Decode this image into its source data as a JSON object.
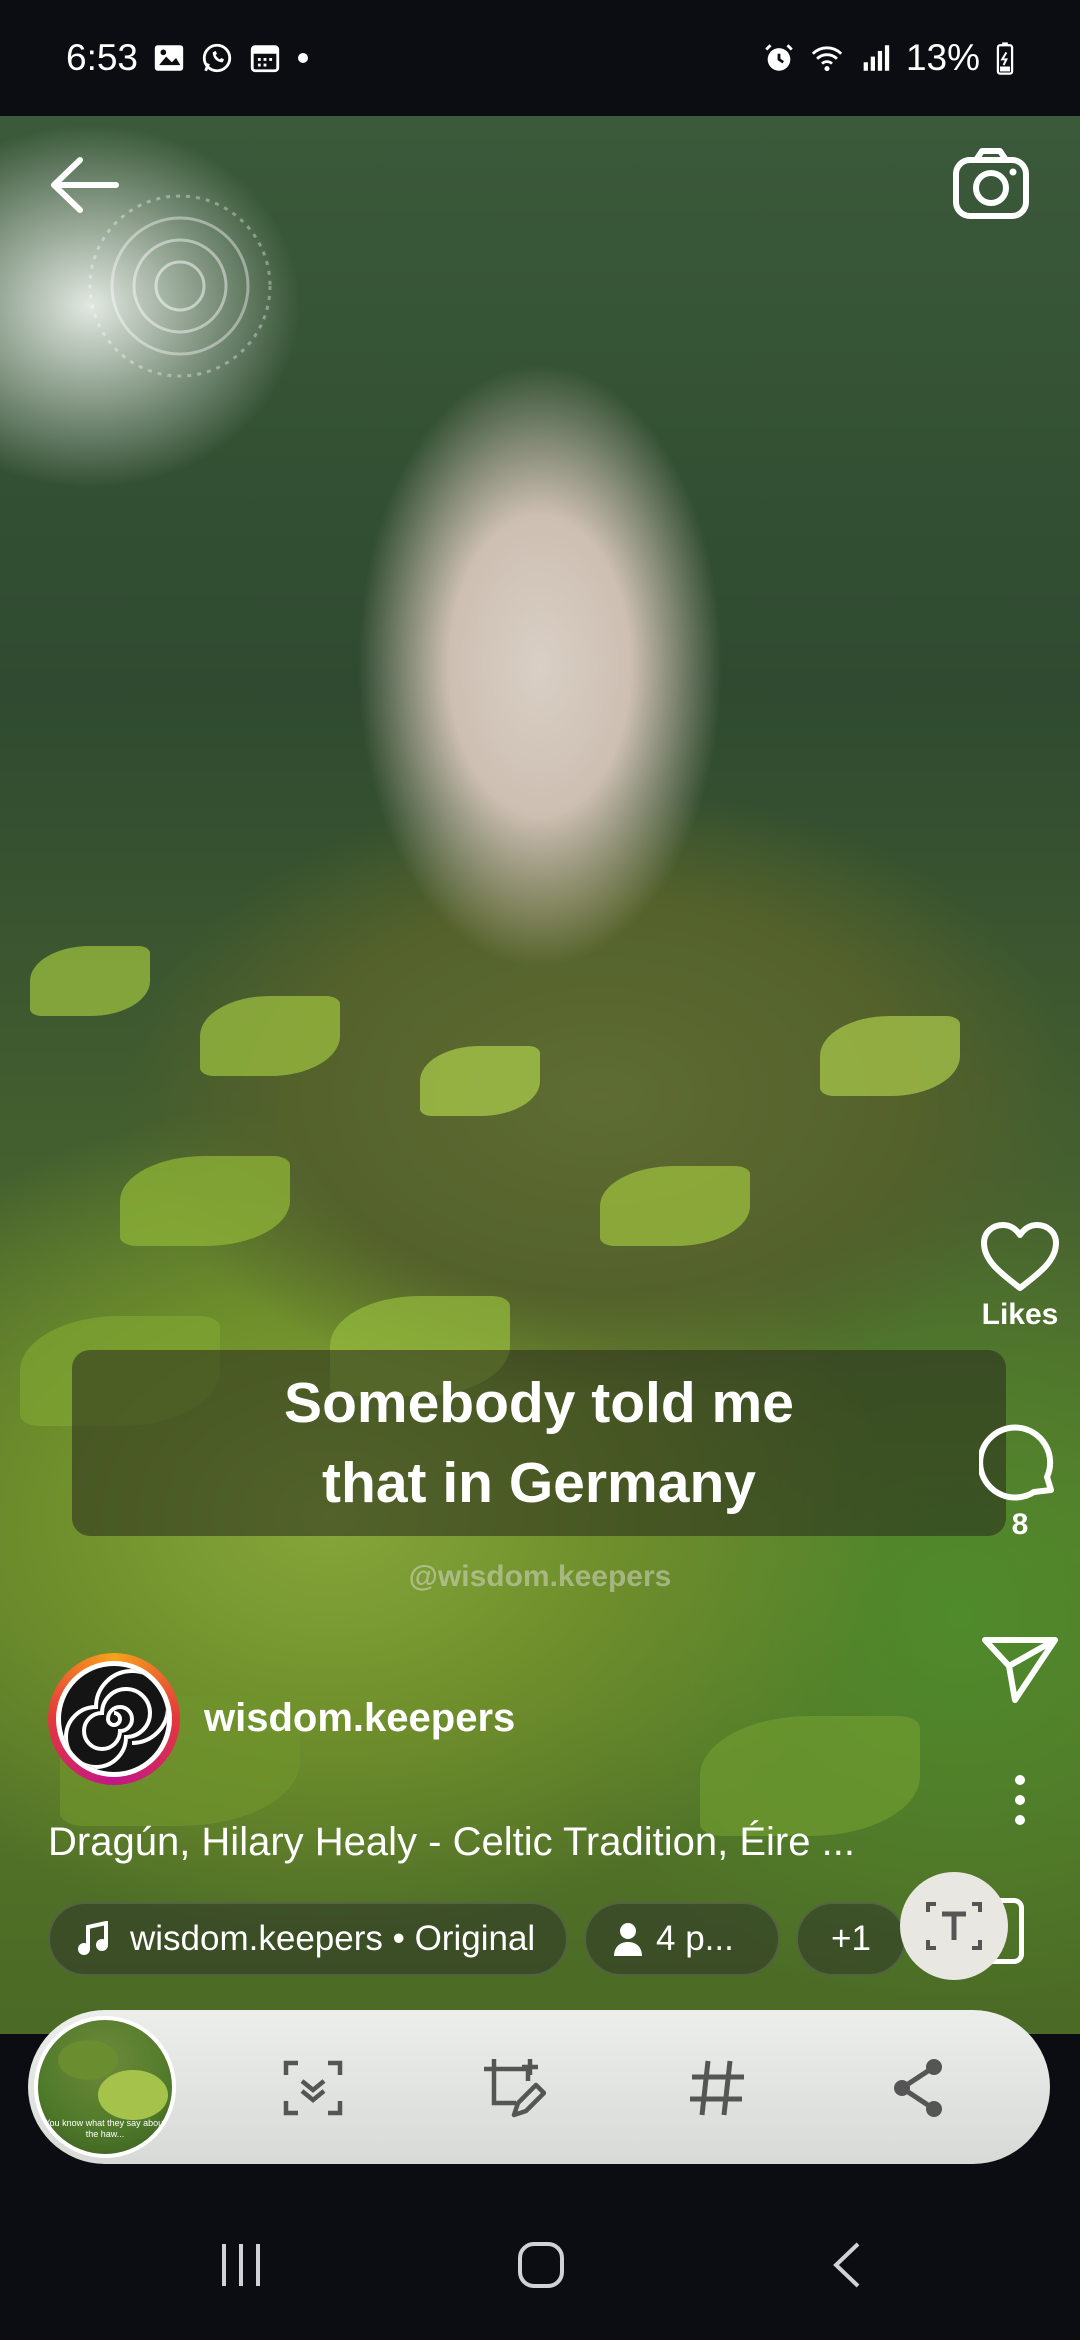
{
  "status_bar": {
    "time": "6:53",
    "battery": "13%",
    "left_icons": [
      "gallery-icon",
      "whatsapp-icon",
      "calendar-icon",
      "dot-icon"
    ],
    "right_icons": [
      "alarm-icon",
      "wifi-icon",
      "signal-icon",
      "battery-icon"
    ]
  },
  "top_bar": {
    "back_icon": "arrow-left-icon",
    "camera_icon": "camera-icon"
  },
  "video": {
    "caption_line1": "Somebody told me",
    "caption_line2": "that in Germany",
    "watermark": "@wisdom.keepers"
  },
  "side_actions": {
    "likes_label": "Likes",
    "comments_count": "8",
    "share_icon": "send-icon",
    "more_icon": "more-vertical-icon"
  },
  "post": {
    "username": "wisdom.keepers",
    "description": "Dragún, Hilary Healy - Celtic Tradition, Éire ...",
    "audio_label": "wisdom.keepers • Original",
    "people_label": "4 p...",
    "more_label": "+1"
  },
  "toolbar": {
    "thumbnail_text": "You know what they say about the haw...",
    "icons": [
      "scan-text-icon",
      "crop-edit-icon",
      "hashtag-icon",
      "share-icon"
    ]
  },
  "nav_bar": {
    "icons": [
      "recents-icon",
      "home-icon",
      "back-icon"
    ]
  },
  "colors": {
    "background": "#0b0d12",
    "toolbar": "#e3e5e3",
    "story_ring": "#e4373c"
  }
}
